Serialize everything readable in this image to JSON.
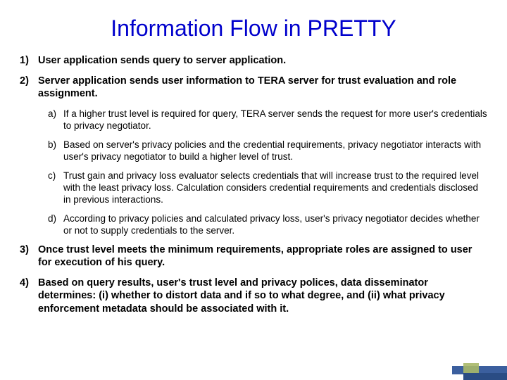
{
  "title": "Information Flow in PRETTY",
  "items": [
    {
      "text": "User application sends query to server application."
    },
    {
      "text": "Server application sends user information to TERA server for trust evaluation and role assignment.",
      "sub": [
        "If a higher trust level is required for query, TERA server sends the request for more user's credentials to privacy negotiator.",
        "Based on server's privacy policies and the credential requirements, privacy negotiator interacts with user's privacy negotiator to build a higher level of trust.",
        "Trust gain and privacy loss evaluator selects credentials that will increase trust to the required level with the least privacy loss. Calculation considers credential requirements and credentials disclosed in previous interactions.",
        "According to privacy policies and calculated privacy loss, user's privacy negotiator decides whether or not to supply credentials to the server."
      ]
    },
    {
      "text": "Once trust level meets the minimum requirements, appropriate roles are assigned to user for execution of his query."
    },
    {
      "text": "Based on query results, user's trust level and privacy polices, data disseminator determines: (i) whether to distort data and if so to what degree, and (ii) what privacy enforcement metadata should be associated with it."
    }
  ]
}
